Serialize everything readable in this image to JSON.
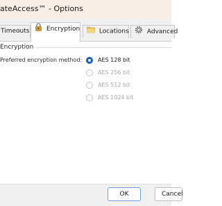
{
  "window": {
    "title": "ateAccess™ - Options"
  },
  "tabs": [
    {
      "label": "Timeouts",
      "icon": "clock-icon"
    },
    {
      "label": "Encryption",
      "icon": "lock-icon",
      "active": true
    },
    {
      "label": "Locations",
      "icon": "folder-icon"
    },
    {
      "label": "Advanced",
      "icon": "gear-icon"
    }
  ],
  "encryption": {
    "group_title": "Encryption",
    "method_label": "Preferred encryption method:",
    "options": [
      {
        "label": "AES 128 bit",
        "selected": true,
        "enabled": true
      },
      {
        "label": "AES 256 bit",
        "selected": false,
        "enabled": false
      },
      {
        "label": "AES 512 bit",
        "selected": false,
        "enabled": false
      },
      {
        "label": "AES 1024 bit",
        "selected": false,
        "enabled": false
      }
    ]
  },
  "buttons": {
    "ok": "OK",
    "cancel": "Cancel"
  },
  "colors": {
    "accent": "#1a5fb4",
    "titlebar": "#f6ede4",
    "disabled_text": "#a8a8a8"
  }
}
